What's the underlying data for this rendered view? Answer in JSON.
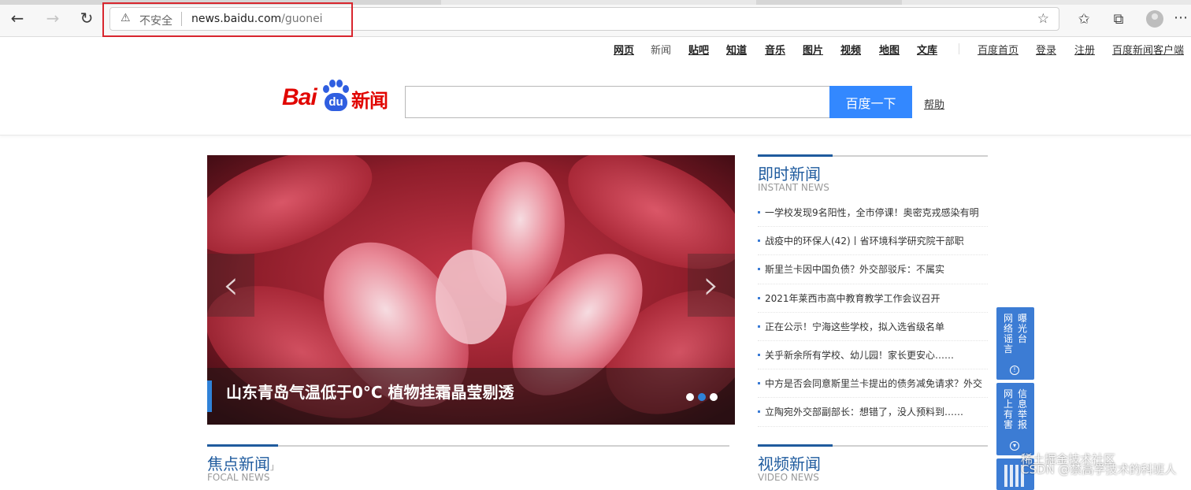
{
  "browser": {
    "security_label": "不安全",
    "url_host": "news.baidu.com",
    "url_path": "/guonei"
  },
  "topnav": {
    "items": [
      "网页",
      "新闻",
      "贴吧",
      "知道",
      "音乐",
      "图片",
      "视频",
      "地图",
      "文库"
    ],
    "right_links": [
      "百度首页",
      "登录",
      "注册",
      "百度新闻客户端"
    ]
  },
  "header": {
    "logo_bai": "Bai",
    "logo_du": "du",
    "logo_news": "新闻",
    "search_value": "",
    "search_button": "百度一下",
    "help_link": "帮助"
  },
  "carousel": {
    "caption": "山东青岛气温低于0°C 植物挂霜晶莹剔透",
    "slide_count": 3,
    "active_slide": 2
  },
  "instant_news": {
    "title": "即时新闻",
    "subtitle": "INSTANT NEWS",
    "items": [
      "一学校发现9名阳性，全市停课！奥密克戎感染有明",
      "战疫中的环保人(42)丨省环境科学研究院干部职",
      "斯里兰卡因中国负债？外交部驳斥：不属实",
      "2021年莱西市高中教育教学工作会议召开",
      "正在公示！宁海这些学校，拟入选省级名单",
      "关乎新余所有学校、幼儿园！家长更安心……",
      "中方是否会同意斯里兰卡提出的债务减免请求？外交",
      "立陶宛外交部副部长：想错了，没人预料到……"
    ]
  },
  "focal_news": {
    "title": "焦点新闻",
    "subtitle": "FOCAL NEWS",
    "mark": "」"
  },
  "video_news": {
    "title": "视频新闻",
    "subtitle": "VIDEO NEWS"
  },
  "side_buttons": {
    "rumor": [
      "网络谣言",
      "曝光台"
    ],
    "report": [
      "网上有害",
      "信息举报"
    ]
  },
  "watermark": {
    "line1": "稀土掘金技术社区",
    "line2": "CSDN @禁高学技术的科班人"
  },
  "colors": {
    "accent": "#3388ff",
    "brand_red": "#e10601",
    "section_blue": "#1f5b9e"
  }
}
